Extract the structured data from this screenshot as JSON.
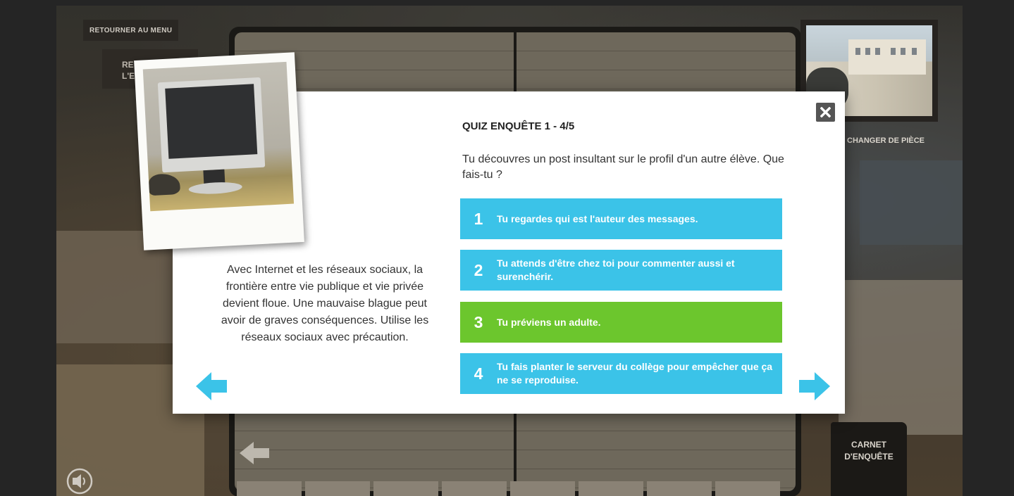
{
  "scene": {
    "menu_button": "RETOURNER AU MENU",
    "back_tile_label": "RE\nL'E",
    "change_room_label": "CHANGER DE PIÈCE",
    "carnet_label_line1": "CARNET",
    "carnet_label_line2": "D'ENQUÊTE"
  },
  "quiz": {
    "title": "QUIZ ENQUÊTE 1 - 4/5",
    "question": "Tu découvres un post insultant sur le profil d'un autre élève. Que fais-tu ?",
    "answers": [
      {
        "number": "1",
        "text": "Tu regardes qui est l'auteur des messages.",
        "state": "default"
      },
      {
        "number": "2",
        "text": "Tu attends d'être chez toi pour commenter aussi et surenchérir.",
        "state": "default"
      },
      {
        "number": "3",
        "text": "Tu préviens un adulte.",
        "state": "correct"
      },
      {
        "number": "4",
        "text": "Tu fais planter le serveur du collège pour empêcher que ça ne se reproduise.",
        "state": "default"
      }
    ],
    "explanation": "Avec Internet et les réseaux sociaux, la frontière entre vie publique et vie privée devient floue. Une mauvaise blague peut avoir de graves conséquences. Utilise les réseaux sociaux avec précaution."
  },
  "colors": {
    "answer_default": "#3bc3e8",
    "answer_correct": "#6cc62d",
    "arrow": "#3bc3e8"
  },
  "icons": {
    "close": "close-icon",
    "prev": "arrow-left-icon",
    "next": "arrow-right-icon",
    "sound": "speaker-icon"
  }
}
